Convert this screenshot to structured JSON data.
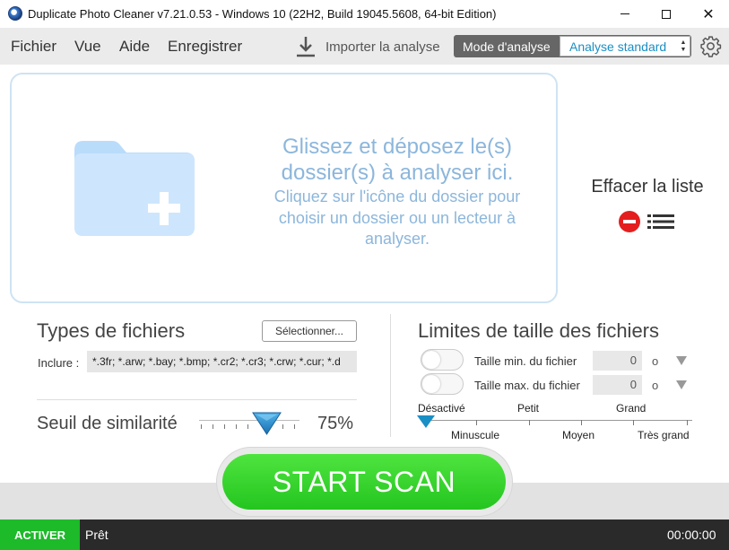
{
  "window": {
    "title": "Duplicate Photo Cleaner v7.21.0.53 - Windows 10 (22H2, Build 19045.5608, 64-bit Edition)",
    "minimize": "",
    "close": "✕"
  },
  "menu": {
    "items": [
      "Fichier",
      "Vue",
      "Aide",
      "Enregistrer"
    ],
    "import_label": "Importer la analyse",
    "mode_label": "Mode d'analyse",
    "mode_value": "Analyse standard",
    "settings_icon": "gear-icon"
  },
  "dropzone": {
    "title": "Glissez et déposez le(s) dossier(s) à analyser ici.",
    "subtitle": "Cliquez sur l'icône du dossier pour choisir un dossier ou un lecteur à analyser.",
    "icon": "folder-add-icon"
  },
  "clear_list": {
    "label": "Effacer la liste",
    "icon": "clear-list-icon"
  },
  "file_types": {
    "title": "Types de fichiers",
    "select_button": "Sélectionner...",
    "include_label": "Inclure :",
    "include_value": "*.3fr; *.arw; *.bay; *.bmp; *.cr2; *.cr3; *.crw; *.cur; *.d"
  },
  "similarity": {
    "title": "Seuil de similarité",
    "value": "75%",
    "level": 0.75
  },
  "size_limits": {
    "title": "Limites de taille des fichiers",
    "min_label": "Taille min. du fichier",
    "min_value": "0",
    "min_unit": "o",
    "max_label": "Taille max. du fichier",
    "max_value": "0",
    "max_unit": "o",
    "scale_top": [
      "Désactivé",
      "Petit",
      "Grand"
    ],
    "scale_bottom": [
      "Minuscule",
      "Moyen",
      "Très grand"
    ],
    "selected": "Désactivé"
  },
  "scan": {
    "label": "START SCAN"
  },
  "status": {
    "activate": "ACTIVER",
    "text": "Prêt",
    "time": "00:00:00"
  },
  "colors": {
    "accent": "#1a8fc4",
    "scan_green": "#2ccc24",
    "activate_green": "#1dba2a",
    "drop_text": "#8cb6db"
  }
}
